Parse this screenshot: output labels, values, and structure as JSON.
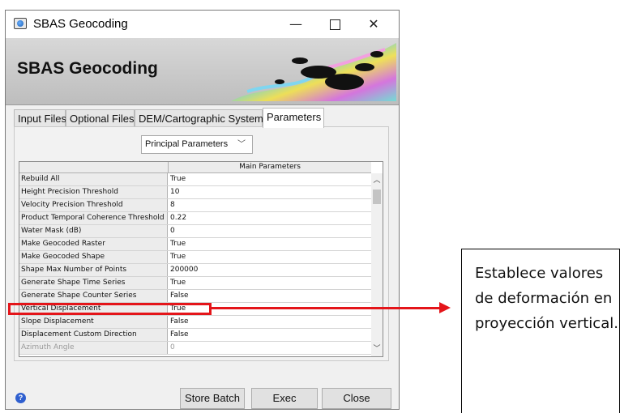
{
  "window": {
    "title": "SBAS Geocoding",
    "minimize_glyph": "—",
    "close_glyph": "✕"
  },
  "banner": {
    "title": "SBAS Geocoding"
  },
  "tabs": [
    {
      "label": "Input Files"
    },
    {
      "label": "Optional Files"
    },
    {
      "label": "DEM/Cartographic System"
    },
    {
      "label": "Parameters"
    }
  ],
  "selector": {
    "value": "Principal Parameters"
  },
  "table": {
    "header": "Main Parameters",
    "rows": [
      {
        "name": "Rebuild All",
        "value": "True"
      },
      {
        "name": "Height Precision Threshold",
        "value": "10"
      },
      {
        "name": "Velocity Precision Threshold",
        "value": "8"
      },
      {
        "name": "Product Temporal Coherence Threshold",
        "value": "0.22"
      },
      {
        "name": "Water Mask (dB)",
        "value": "0"
      },
      {
        "name": "Make Geocoded Raster",
        "value": "True"
      },
      {
        "name": "Make Geocoded Shape",
        "value": "True"
      },
      {
        "name": "Shape Max Number of Points",
        "value": "200000"
      },
      {
        "name": "Generate Shape Time Series",
        "value": "True"
      },
      {
        "name": "Generate Shape Counter Series",
        "value": "False"
      },
      {
        "name": "Vertical Displacement",
        "value": "True"
      },
      {
        "name": "Slope Displacement",
        "value": "False"
      },
      {
        "name": "Displacement Custom Direction",
        "value": "False"
      },
      {
        "name": "Azimuth Angle",
        "value": "0"
      }
    ]
  },
  "footer": {
    "help_glyph": "?",
    "store_batch_label": "Store Batch",
    "exec_label": "Exec",
    "close_label": "Close"
  },
  "annotation": {
    "callout_text": "Establece valores de deformación en proyección vertical."
  },
  "colors": {
    "highlight": "#e4151a",
    "help": "#2f5fcf"
  }
}
